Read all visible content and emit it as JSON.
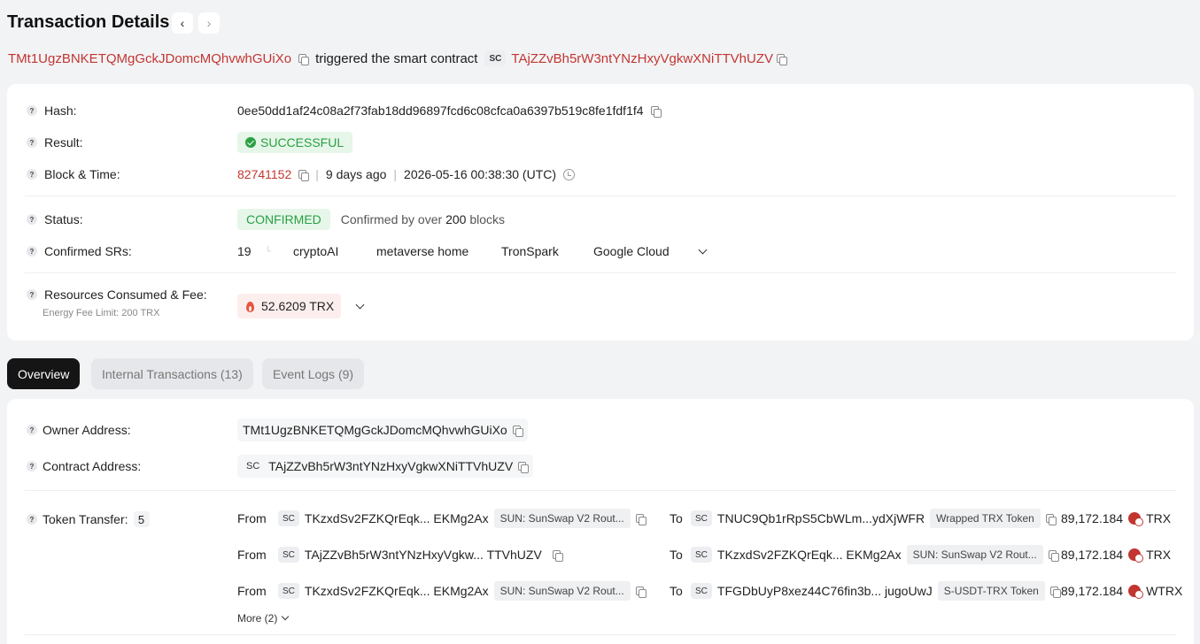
{
  "header": {
    "title": "Transaction Details",
    "prev_icon": "chevron-left-icon",
    "next_icon": "chevron-right-icon"
  },
  "subline": {
    "from_address": "TMt1UgzBNKETQMgGckJDomcMQhvwhGUiXo",
    "action_text": "triggered the smart contract",
    "sc_badge": "SC",
    "contract_address": "TAjZZvBh5rW3ntYNzHxyVgkwXNiTTVhUZV"
  },
  "summary": {
    "hash_label": "Hash:",
    "hash_value": "0ee50dd1af24c08a2f73fab18dd96897fcd6c08cfca0a6397b519c8fe1fdf1f4",
    "result_label": "Result:",
    "result_value": "SUCCESSFUL",
    "block_label": "Block & Time:",
    "block_number": "82741152",
    "time_ago": "9 days ago",
    "timestamp": "2026-05-16 00:38:30 (UTC)",
    "status_label": "Status:",
    "status_value": "CONFIRMED",
    "status_note_prefix": "Confirmed by over",
    "status_note_count": "200",
    "status_note_suffix": "blocks",
    "srs_label": "Confirmed SRs:",
    "srs_count": "19",
    "srs_names": [
      "cryptoAI",
      "metaverse home",
      "TronSpark",
      "Google Cloud"
    ],
    "resources_label": "Resources Consumed & Fee:",
    "energy_limit": "Energy Fee Limit: 200 TRX",
    "fee_value": "52.6209 TRX"
  },
  "tabs": [
    {
      "label": "Overview",
      "active": true
    },
    {
      "label": "Internal Transactions (13)",
      "active": false
    },
    {
      "label": "Event Logs (9)",
      "active": false
    }
  ],
  "overview": {
    "owner_label": "Owner Address:",
    "owner_value": "TMt1UgzBNKETQMgGckJDomcMQhvwhGUiXo",
    "contract_label": "Contract Address:",
    "contract_sc": "SC",
    "contract_value": "TAjZZvBh5rW3ntYNzHxyVgkwXNiTTVhUZV",
    "token_transfer_label": "Token Transfer:",
    "token_transfer_count": "5",
    "from_word": "From",
    "to_word": "To",
    "transfers": [
      {
        "from_head": "TKzxdSv2FZKQrEqk...",
        "from_tail": "EKMg2Ax",
        "from_tag": "SUN: SunSwap V2 Rout...",
        "to_head": "TNUC9Qb1rRpS5CbWLm...",
        "to_tail": "ydXjWFR",
        "to_tag": "Wrapped TRX Token",
        "amount": "89,172.184",
        "token": "TRX"
      },
      {
        "from_head": "TAjZZvBh5rW3ntYNzHxyVgkw...",
        "from_tail": "TTVhUZV",
        "from_tag": "",
        "to_head": "TKzxdSv2FZKQrEqk...",
        "to_tail": "EKMg2Ax",
        "to_tag": "SUN: SunSwap V2 Rout...",
        "amount": "89,172.184",
        "token": "TRX"
      },
      {
        "from_head": "TKzxdSv2FZKQrEqk...",
        "from_tail": "EKMg2Ax",
        "from_tag": "SUN: SunSwap V2 Rout...",
        "to_head": "TFGDbUyP8xez44C76fin3b...",
        "to_tail": "jugoUwJ",
        "to_tag": "S-USDT-TRX Token",
        "amount": "89,172.184",
        "token": "WTRX"
      }
    ],
    "more_label": "More (2)"
  },
  "colors": {
    "accent_red": "#c23631",
    "success_green": "#2aa043",
    "active_tab_bg": "#151515"
  }
}
